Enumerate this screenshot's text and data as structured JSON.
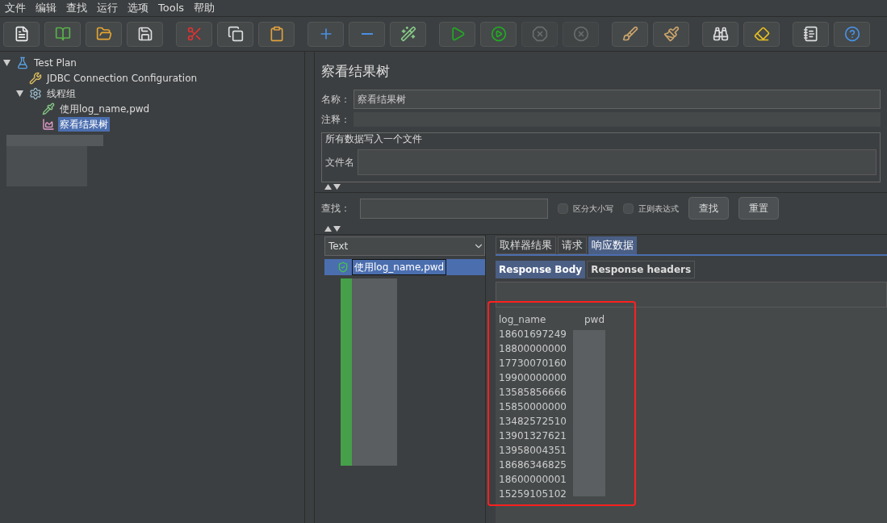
{
  "menu": [
    "文件",
    "编辑",
    "查找",
    "运行",
    "选项",
    "Tools",
    "帮助"
  ],
  "toolbar": [
    {
      "disabled": false
    },
    {
      "disabled": false
    },
    {
      "disabled": false
    },
    {
      "disabled": false
    },
    {
      "disabled": false
    },
    {
      "disabled": false
    },
    {
      "disabled": false
    },
    {
      "disabled": false
    },
    {
      "disabled": false
    },
    {
      "disabled": false
    },
    {
      "disabled": false
    },
    {
      "disabled": false
    },
    {
      "disabled": true
    },
    {
      "disabled": true
    },
    {
      "disabled": false
    },
    {
      "disabled": false
    },
    {
      "disabled": false
    },
    {
      "disabled": false
    },
    {
      "disabled": false
    },
    {
      "disabled": false
    }
  ],
  "tree": [
    {
      "label": "Test Plan",
      "kind": "plan",
      "expanded": true,
      "selected": false,
      "children": [
        {
          "label": "JDBC Connection Configuration",
          "kind": "config",
          "selected": false
        },
        {
          "label": "线程组",
          "kind": "group",
          "expanded": true,
          "selected": false,
          "children": [
            {
              "label": "使用log_name,pwd",
              "kind": "sampler",
              "selected": false
            },
            {
              "label": "察看结果树",
              "kind": "listener",
              "selected": true
            }
          ]
        }
      ]
    }
  ],
  "panel": {
    "title": "察看结果树",
    "name_label": "名称：",
    "name_value": "察看结果树",
    "comment_label": "注释：",
    "file_group": {
      "legend": "所有数据写入一个文件",
      "file_label": "文件名"
    },
    "search": {
      "label": "查找：",
      "options": [
        {
          "label": "区分大小写",
          "checked": false
        },
        {
          "label": "正则表达式",
          "checked": false
        }
      ],
      "buttons": [
        "查找",
        "重置"
      ]
    },
    "renderer": "Text",
    "results": [
      {
        "label": "使用log_name,pwd",
        "selected": true
      }
    ],
    "tabs": [
      {
        "label": "取样器结果",
        "selected": false
      },
      {
        "label": "请求",
        "selected": false
      },
      {
        "label": "响应数据",
        "selected": true
      }
    ],
    "subtabs": [
      {
        "label": "Response Body",
        "selected": true
      },
      {
        "label": "Response headers",
        "selected": false
      }
    ],
    "response": {
      "columns": [
        "log_name",
        "pwd"
      ],
      "rows": [
        "18601697249",
        "18800000000",
        "17730070160",
        "19900000000",
        "13585856666",
        "15850000000",
        "13482572510",
        "13901327621",
        "13958004351",
        "18686346825",
        "18600000001",
        "15259105102"
      ]
    }
  }
}
